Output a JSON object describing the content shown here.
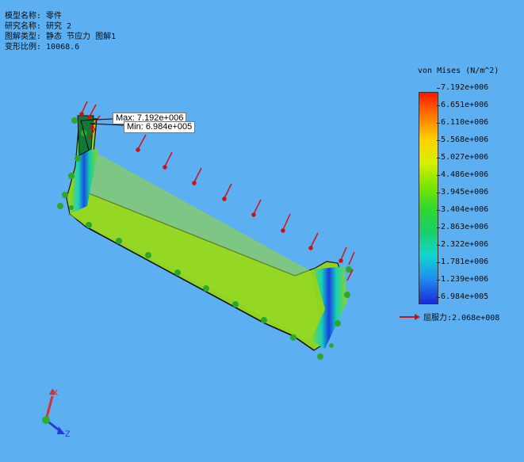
{
  "info": {
    "model_name": "模型名称: 零件",
    "study_name": "研究名称: 研究 2",
    "plot_type": "图解类型: 静态 节应力 图解1",
    "deformation_scale": "变形比例: 10068.6"
  },
  "callouts": {
    "max_label": "Max: 7.192e+006",
    "min_label": "Min: 6.984e+005"
  },
  "legend": {
    "title": "von Mises (N/m^2)",
    "ticks": [
      "7.192e+006",
      "6.651e+006",
      "6.110e+006",
      "5.568e+006",
      "5.027e+006",
      "4.486e+006",
      "3.945e+006",
      "3.404e+006",
      "2.863e+006",
      "2.322e+006",
      "1.781e+006",
      "1.239e+006",
      "6.984e+005"
    ],
    "yield_label": "屈服力:2.068e+008",
    "colors": {
      "max": "#ff1500",
      "mid": "#7ee600",
      "min": "#1c2ad8"
    }
  },
  "triad": {
    "x_label": "X",
    "z_label": "Z"
  },
  "colors": {
    "background": "#5cb0f2",
    "part": "#8fd420",
    "load_arrow": "#d01010",
    "fixture": "#2ba82b"
  }
}
